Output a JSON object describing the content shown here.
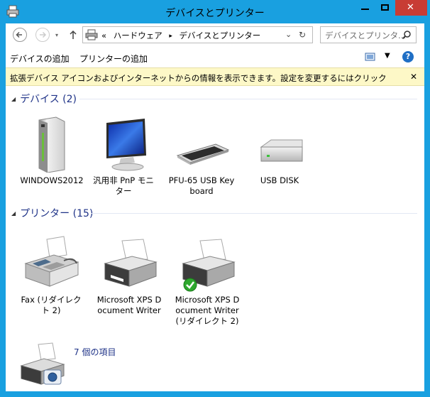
{
  "window": {
    "title": "デバイスとプリンター",
    "min_glyph": "—",
    "max_glyph": "□",
    "close_glyph": "✕"
  },
  "address": {
    "chevrons": "«",
    "crumbs": [
      "ハードウェア",
      "デバイスとプリンター"
    ],
    "separator": "▸",
    "dropdown": "⌄",
    "refresh": "↻"
  },
  "search": {
    "placeholder": "デバイスとプリンタ..."
  },
  "commands": {
    "add_device": "デバイスの追加",
    "add_printer": "プリンターの追加"
  },
  "infobar": {
    "text": "拡張デバイス アイコンおよびインターネットからの情報を表示できます。設定を変更するにはクリックしてください...",
    "close": "✕"
  },
  "groups": {
    "devices": {
      "title": "デバイス (2)"
    },
    "printers": {
      "title": "プリンター (15)"
    }
  },
  "devices": [
    {
      "label": "WINDOWS2012",
      "icon": "computer-tower-icon"
    },
    {
      "label": "汎用非 PnP モニター",
      "icon": "monitor-icon"
    },
    {
      "label": "PFU-65 USB Keyboard",
      "icon": "keyboard-icon"
    },
    {
      "label": "USB DISK",
      "icon": "drive-icon"
    }
  ],
  "printers": [
    {
      "label": "Fax (リダイレクト 2)",
      "icon": "fax-icon"
    },
    {
      "label": "Microsoft XPS Document Writer",
      "icon": "printer-icon"
    },
    {
      "label": "Microsoft XPS Document Writer (リダイレクト 2)",
      "icon": "printer-default-icon"
    }
  ],
  "status": {
    "text": "7 個の項目"
  },
  "help_glyph": "?",
  "colors": {
    "title_bar": "#19a0e0",
    "close_button": "#c83c34",
    "group_header": "#1e3287",
    "info_bar": "#fdf8c7"
  }
}
